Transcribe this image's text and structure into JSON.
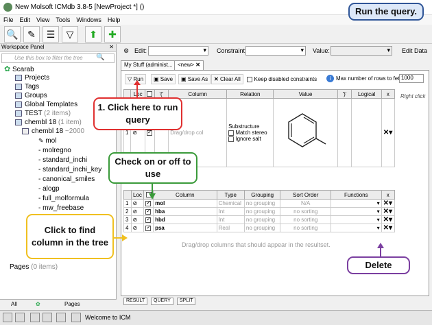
{
  "window": {
    "title": "New Molsoft ICMdb 3.8-5  [NewProject *] ()"
  },
  "menu": [
    "File",
    "Edit",
    "View",
    "Tools",
    "Windows",
    "Help"
  ],
  "toolbar": {
    "icons": [
      "search-icon",
      "edit-icon",
      "list-icon",
      "filter-icon",
      "upload-icon",
      "add-user-icon"
    ]
  },
  "workspace": {
    "title": "Workspace Panel",
    "filter_placeholder": "Use this box to filter the tree",
    "root": "Scarab",
    "items": [
      {
        "label": "Projects"
      },
      {
        "label": "Tags"
      },
      {
        "label": "Groups"
      },
      {
        "label": "Global Templates"
      },
      {
        "label": "TEST",
        "count": "(2 items)"
      },
      {
        "label": "chembl 18",
        "count": "(1 item)"
      },
      {
        "label": "chembl 18",
        "count": "~2000"
      }
    ],
    "columns": [
      "mol",
      "molregno",
      "standard_inchi",
      "standard_inchi_key",
      "canonical_smiles",
      "alogp",
      "full_molformula",
      "mw_freebase"
    ],
    "pages": {
      "label": "Pages",
      "count": "(0 items)"
    },
    "tabs": [
      "All",
      "Pages"
    ]
  },
  "constraint_bar": {
    "edit_label": "Edit:",
    "constraint_label": "Constraint:",
    "value_label": "Value:",
    "edit_data": "Edit Data"
  },
  "doc_tabs": [
    "My Stuff (administ...",
    "<new>"
  ],
  "query_toolbar": {
    "run": "Run",
    "save": "Save",
    "save_as": "Save As",
    "clear_all": "Clear All",
    "keep_disabled": "Keep disabled constraints",
    "max_rows_label": "Max number of rows to fetch",
    "max_rows_value": "1000"
  },
  "constraint_table": {
    "headers": [
      "",
      "Loc",
      "",
      "'('",
      "Column",
      "Relation",
      "Value",
      "')'",
      "Logical",
      "x"
    ],
    "relation": "Substructure",
    "match_stereo": "Match stereo",
    "ignore_salt": "Ignore salt",
    "drag_hint": "Drag/drop col"
  },
  "columns_table": {
    "headers": [
      "",
      "Loc",
      "",
      "Column",
      "Type",
      "Grouping",
      "Sort Order",
      "Functions",
      "x"
    ],
    "rows": [
      {
        "n": "1",
        "column": "mol",
        "type": "Chemical",
        "grouping": "no grouping",
        "sort": "N/A"
      },
      {
        "n": "2",
        "column": "hba",
        "type": "Int",
        "grouping": "no grouping",
        "sort": "no sorting"
      },
      {
        "n": "3",
        "column": "hbd",
        "type": "Int",
        "grouping": "no grouping",
        "sort": "no sorting"
      },
      {
        "n": "4",
        "column": "psa",
        "type": "Real",
        "grouping": "no grouping",
        "sort": "no sorting"
      }
    ],
    "drag_hint": "Drag/drop columns that should appear in the resultset."
  },
  "right_click_hint": "Right click",
  "bottom_tabs": [
    "RESULT",
    "QUERY",
    "SPLIT"
  ],
  "status": {
    "message": "Welcome to ICM"
  },
  "callouts": {
    "run_query": "Run the query.",
    "click_run": "1. Click here to run query",
    "check_on_off": "Check on or off to use",
    "find_column": "Click to find column in the tree",
    "delete": "Delete"
  },
  "colors": {
    "callout_blue": "#2f5597",
    "callout_red": "#e03030",
    "callout_green": "#3a9a3a",
    "callout_yellow": "#f0c020",
    "callout_purple": "#7b3fa0"
  }
}
